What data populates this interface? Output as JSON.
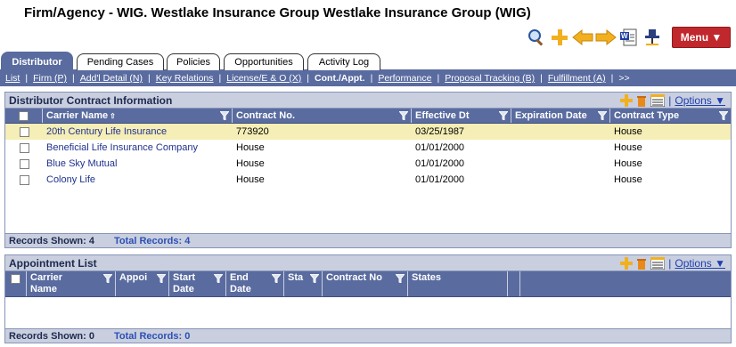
{
  "header": {
    "title": "Firm/Agency - WIG. Westlake Insurance Group Westlake Insurance Group (WIG)"
  },
  "toolbar": {
    "icons": [
      "search-icon",
      "add-icon",
      "back-arrow-icon",
      "forward-arrow-icon",
      "word-document-icon",
      "pin-icon"
    ],
    "menu_label": "Menu ▼"
  },
  "tabs": [
    {
      "label": "Distributor",
      "active": true
    },
    {
      "label": "Pending Cases"
    },
    {
      "label": "Policies"
    },
    {
      "label": "Opportunities"
    },
    {
      "label": "Activity Log"
    }
  ],
  "subnav": {
    "items": [
      "List",
      "Firm (P)",
      "Add'l Detail (N)",
      "Key Relations",
      "License/E & O (X)",
      "Cont./Appt.",
      "Performance",
      "Proposal Tracking (B)",
      "Fulfillment (A)",
      ">>"
    ],
    "current_index": 5
  },
  "contract_panel": {
    "title": "Distributor Contract Information",
    "options_label": "Options ▼",
    "columns": [
      "Carrier Name",
      "Contract No.",
      "Effective Dt",
      "Expiration Date",
      "Contract Type"
    ],
    "rows": [
      [
        "20th Century Life Insurance",
        "773920",
        "03/25/1987",
        "",
        "House"
      ],
      [
        "Beneficial Life Insurance Company",
        "House",
        "01/01/2000",
        "",
        "House"
      ],
      [
        "Blue Sky Mutual",
        "House",
        "01/01/2000",
        "",
        "House"
      ],
      [
        "Colony Life",
        "House",
        "01/01/2000",
        "",
        "House"
      ]
    ],
    "records_shown": "Records Shown: 4",
    "total_records": "Total Records: 4"
  },
  "appointment_panel": {
    "title": "Appointment List",
    "options_label": "Options ▼",
    "columns": [
      "Carrier Name",
      "Appoi",
      "Start Date",
      "End Date",
      "Sta",
      "Contract No",
      "States"
    ],
    "records_shown": "Records Shown: 0",
    "total_records": "Total Records: 0"
  },
  "colors": {
    "accent": "#596b9f",
    "selected_row": "#f5eeb6",
    "menu": "#c0282d"
  }
}
